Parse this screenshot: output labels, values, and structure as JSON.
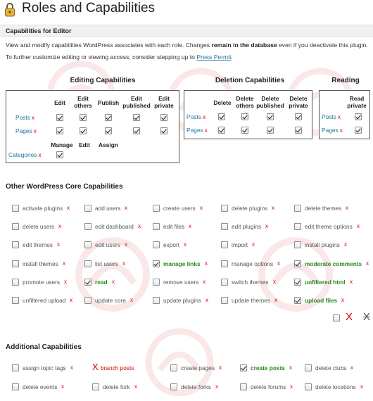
{
  "page": {
    "title": "Roles and Capabilities"
  },
  "section": {
    "title": "Capabilities for Editor"
  },
  "intro": {
    "line1_pre": "View and modify capabilities WordPress associates with each role. Changes ",
    "line1_bold": "remain in the database",
    "line1_post": " even if you deactivate this plugin.",
    "line2_pre": "To further customize editing or viewing access, consider stepping up to ",
    "line2_link": "Press Permit",
    "line2_post": "."
  },
  "editing": {
    "title": "Editing Capabilities",
    "headers": [
      "Edit",
      "Edit others",
      "Publish",
      "Edit published",
      "Edit private"
    ],
    "rows": [
      {
        "label": "Posts",
        "x": "x"
      },
      {
        "label": "Pages",
        "x": "x"
      }
    ],
    "sub_headers": [
      "Manage",
      "Edit",
      "Assign"
    ],
    "sub_row": {
      "label": "Categories",
      "x": "x"
    }
  },
  "deletion": {
    "title": "Deletion Capabilities",
    "headers": [
      "Delete",
      "Delete others",
      "Delete published",
      "Delete private"
    ],
    "rows": [
      {
        "label": "Posts",
        "x": "x"
      },
      {
        "label": "Pages",
        "x": "x"
      }
    ]
  },
  "reading": {
    "title": "Reading",
    "headers": [
      "Read private"
    ],
    "rows": [
      {
        "label": "Posts",
        "x": "x"
      },
      {
        "label": "Pages",
        "x": "x"
      }
    ]
  },
  "core": {
    "title": "Other WordPress Core Capabilities",
    "x": "x",
    "items": [
      {
        "label": "activate plugins",
        "checked": false
      },
      {
        "label": "add users",
        "checked": false
      },
      {
        "label": "create users",
        "checked": false
      },
      {
        "label": "delete plugins",
        "checked": false
      },
      {
        "label": "delete themes",
        "checked": false
      },
      {
        "label": "delete users",
        "checked": false
      },
      {
        "label": "edit dashboard",
        "checked": false
      },
      {
        "label": "edit files",
        "checked": false
      },
      {
        "label": "edit plugins",
        "checked": false
      },
      {
        "label": "edit theme options",
        "checked": false
      },
      {
        "label": "edit themes",
        "checked": false
      },
      {
        "label": "edit users",
        "checked": false
      },
      {
        "label": "export",
        "checked": false
      },
      {
        "label": "import",
        "checked": false
      },
      {
        "label": "install plugins",
        "checked": false
      },
      {
        "label": "install themes",
        "checked": false
      },
      {
        "label": "list users",
        "checked": false
      },
      {
        "label": "manage links",
        "checked": true
      },
      {
        "label": "manage options",
        "checked": false
      },
      {
        "label": "moderate comments",
        "checked": true
      },
      {
        "label": "promote users",
        "checked": false
      },
      {
        "label": "read",
        "checked": true
      },
      {
        "label": "remove users",
        "checked": false
      },
      {
        "label": "switch themes",
        "checked": false
      },
      {
        "label": "unfiltered html",
        "checked": true
      },
      {
        "label": "unfiltered upload",
        "checked": false
      },
      {
        "label": "update core",
        "checked": false
      },
      {
        "label": "update plugins",
        "checked": false
      },
      {
        "label": "update themes",
        "checked": false
      },
      {
        "label": "upload files",
        "checked": true
      }
    ],
    "bulk_x": "X",
    "bulk_strike_x": "X"
  },
  "additional": {
    "title": "Additional Capabilities",
    "x": "x",
    "items": [
      {
        "label": "assign topic tags",
        "checked": false,
        "removed": false
      },
      {
        "label": "branch posts",
        "checked": false,
        "removed": true,
        "mark": "X"
      },
      {
        "label": "create pages",
        "checked": false,
        "removed": false
      },
      {
        "label": "create posts",
        "checked": true,
        "removed": false
      },
      {
        "label": "delete clubs",
        "checked": false,
        "removed": false
      },
      {
        "label": "delete events",
        "checked": false,
        "removed": false
      },
      {
        "label": "delete fork",
        "checked": false,
        "removed": false
      },
      {
        "label": "delete forks",
        "checked": false,
        "removed": false
      },
      {
        "label": "delete forums",
        "checked": false,
        "removed": false
      },
      {
        "label": "delete locations",
        "checked": false,
        "removed": false
      }
    ]
  },
  "colors": {
    "link": "#21759b",
    "remove": "#dd0000",
    "granted": "#2a8a1e"
  }
}
